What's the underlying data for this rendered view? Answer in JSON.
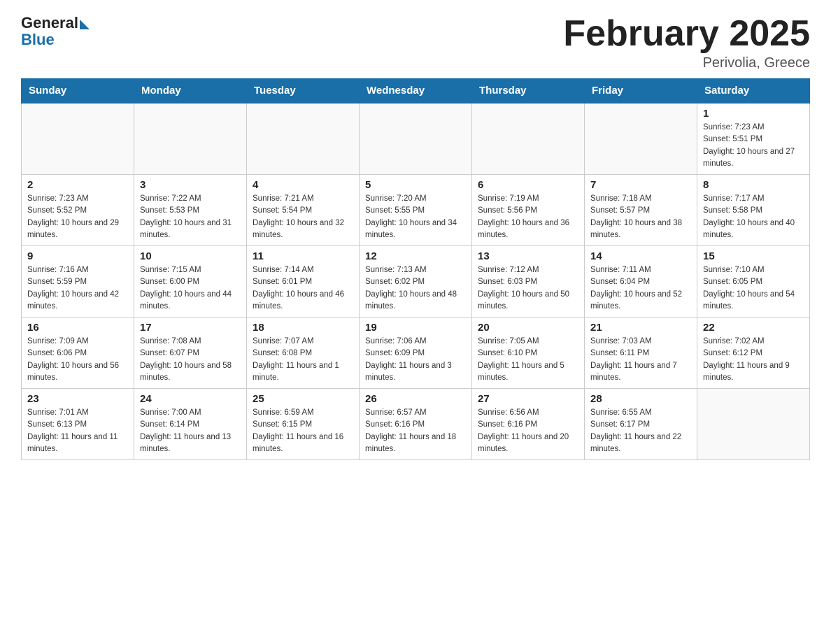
{
  "logo": {
    "general": "General",
    "blue": "Blue"
  },
  "header": {
    "title": "February 2025",
    "location": "Perivolia, Greece"
  },
  "weekdays": [
    "Sunday",
    "Monday",
    "Tuesday",
    "Wednesday",
    "Thursday",
    "Friday",
    "Saturday"
  ],
  "weeks": [
    [
      {
        "day": "",
        "sunrise": "",
        "sunset": "",
        "daylight": ""
      },
      {
        "day": "",
        "sunrise": "",
        "sunset": "",
        "daylight": ""
      },
      {
        "day": "",
        "sunrise": "",
        "sunset": "",
        "daylight": ""
      },
      {
        "day": "",
        "sunrise": "",
        "sunset": "",
        "daylight": ""
      },
      {
        "day": "",
        "sunrise": "",
        "sunset": "",
        "daylight": ""
      },
      {
        "day": "",
        "sunrise": "",
        "sunset": "",
        "daylight": ""
      },
      {
        "day": "1",
        "sunrise": "Sunrise: 7:23 AM",
        "sunset": "Sunset: 5:51 PM",
        "daylight": "Daylight: 10 hours and 27 minutes."
      }
    ],
    [
      {
        "day": "2",
        "sunrise": "Sunrise: 7:23 AM",
        "sunset": "Sunset: 5:52 PM",
        "daylight": "Daylight: 10 hours and 29 minutes."
      },
      {
        "day": "3",
        "sunrise": "Sunrise: 7:22 AM",
        "sunset": "Sunset: 5:53 PM",
        "daylight": "Daylight: 10 hours and 31 minutes."
      },
      {
        "day": "4",
        "sunrise": "Sunrise: 7:21 AM",
        "sunset": "Sunset: 5:54 PM",
        "daylight": "Daylight: 10 hours and 32 minutes."
      },
      {
        "day": "5",
        "sunrise": "Sunrise: 7:20 AM",
        "sunset": "Sunset: 5:55 PM",
        "daylight": "Daylight: 10 hours and 34 minutes."
      },
      {
        "day": "6",
        "sunrise": "Sunrise: 7:19 AM",
        "sunset": "Sunset: 5:56 PM",
        "daylight": "Daylight: 10 hours and 36 minutes."
      },
      {
        "day": "7",
        "sunrise": "Sunrise: 7:18 AM",
        "sunset": "Sunset: 5:57 PM",
        "daylight": "Daylight: 10 hours and 38 minutes."
      },
      {
        "day": "8",
        "sunrise": "Sunrise: 7:17 AM",
        "sunset": "Sunset: 5:58 PM",
        "daylight": "Daylight: 10 hours and 40 minutes."
      }
    ],
    [
      {
        "day": "9",
        "sunrise": "Sunrise: 7:16 AM",
        "sunset": "Sunset: 5:59 PM",
        "daylight": "Daylight: 10 hours and 42 minutes."
      },
      {
        "day": "10",
        "sunrise": "Sunrise: 7:15 AM",
        "sunset": "Sunset: 6:00 PM",
        "daylight": "Daylight: 10 hours and 44 minutes."
      },
      {
        "day": "11",
        "sunrise": "Sunrise: 7:14 AM",
        "sunset": "Sunset: 6:01 PM",
        "daylight": "Daylight: 10 hours and 46 minutes."
      },
      {
        "day": "12",
        "sunrise": "Sunrise: 7:13 AM",
        "sunset": "Sunset: 6:02 PM",
        "daylight": "Daylight: 10 hours and 48 minutes."
      },
      {
        "day": "13",
        "sunrise": "Sunrise: 7:12 AM",
        "sunset": "Sunset: 6:03 PM",
        "daylight": "Daylight: 10 hours and 50 minutes."
      },
      {
        "day": "14",
        "sunrise": "Sunrise: 7:11 AM",
        "sunset": "Sunset: 6:04 PM",
        "daylight": "Daylight: 10 hours and 52 minutes."
      },
      {
        "day": "15",
        "sunrise": "Sunrise: 7:10 AM",
        "sunset": "Sunset: 6:05 PM",
        "daylight": "Daylight: 10 hours and 54 minutes."
      }
    ],
    [
      {
        "day": "16",
        "sunrise": "Sunrise: 7:09 AM",
        "sunset": "Sunset: 6:06 PM",
        "daylight": "Daylight: 10 hours and 56 minutes."
      },
      {
        "day": "17",
        "sunrise": "Sunrise: 7:08 AM",
        "sunset": "Sunset: 6:07 PM",
        "daylight": "Daylight: 10 hours and 58 minutes."
      },
      {
        "day": "18",
        "sunrise": "Sunrise: 7:07 AM",
        "sunset": "Sunset: 6:08 PM",
        "daylight": "Daylight: 11 hours and 1 minute."
      },
      {
        "day": "19",
        "sunrise": "Sunrise: 7:06 AM",
        "sunset": "Sunset: 6:09 PM",
        "daylight": "Daylight: 11 hours and 3 minutes."
      },
      {
        "day": "20",
        "sunrise": "Sunrise: 7:05 AM",
        "sunset": "Sunset: 6:10 PM",
        "daylight": "Daylight: 11 hours and 5 minutes."
      },
      {
        "day": "21",
        "sunrise": "Sunrise: 7:03 AM",
        "sunset": "Sunset: 6:11 PM",
        "daylight": "Daylight: 11 hours and 7 minutes."
      },
      {
        "day": "22",
        "sunrise": "Sunrise: 7:02 AM",
        "sunset": "Sunset: 6:12 PM",
        "daylight": "Daylight: 11 hours and 9 minutes."
      }
    ],
    [
      {
        "day": "23",
        "sunrise": "Sunrise: 7:01 AM",
        "sunset": "Sunset: 6:13 PM",
        "daylight": "Daylight: 11 hours and 11 minutes."
      },
      {
        "day": "24",
        "sunrise": "Sunrise: 7:00 AM",
        "sunset": "Sunset: 6:14 PM",
        "daylight": "Daylight: 11 hours and 13 minutes."
      },
      {
        "day": "25",
        "sunrise": "Sunrise: 6:59 AM",
        "sunset": "Sunset: 6:15 PM",
        "daylight": "Daylight: 11 hours and 16 minutes."
      },
      {
        "day": "26",
        "sunrise": "Sunrise: 6:57 AM",
        "sunset": "Sunset: 6:16 PM",
        "daylight": "Daylight: 11 hours and 18 minutes."
      },
      {
        "day": "27",
        "sunrise": "Sunrise: 6:56 AM",
        "sunset": "Sunset: 6:16 PM",
        "daylight": "Daylight: 11 hours and 20 minutes."
      },
      {
        "day": "28",
        "sunrise": "Sunrise: 6:55 AM",
        "sunset": "Sunset: 6:17 PM",
        "daylight": "Daylight: 11 hours and 22 minutes."
      },
      {
        "day": "",
        "sunrise": "",
        "sunset": "",
        "daylight": ""
      }
    ]
  ]
}
